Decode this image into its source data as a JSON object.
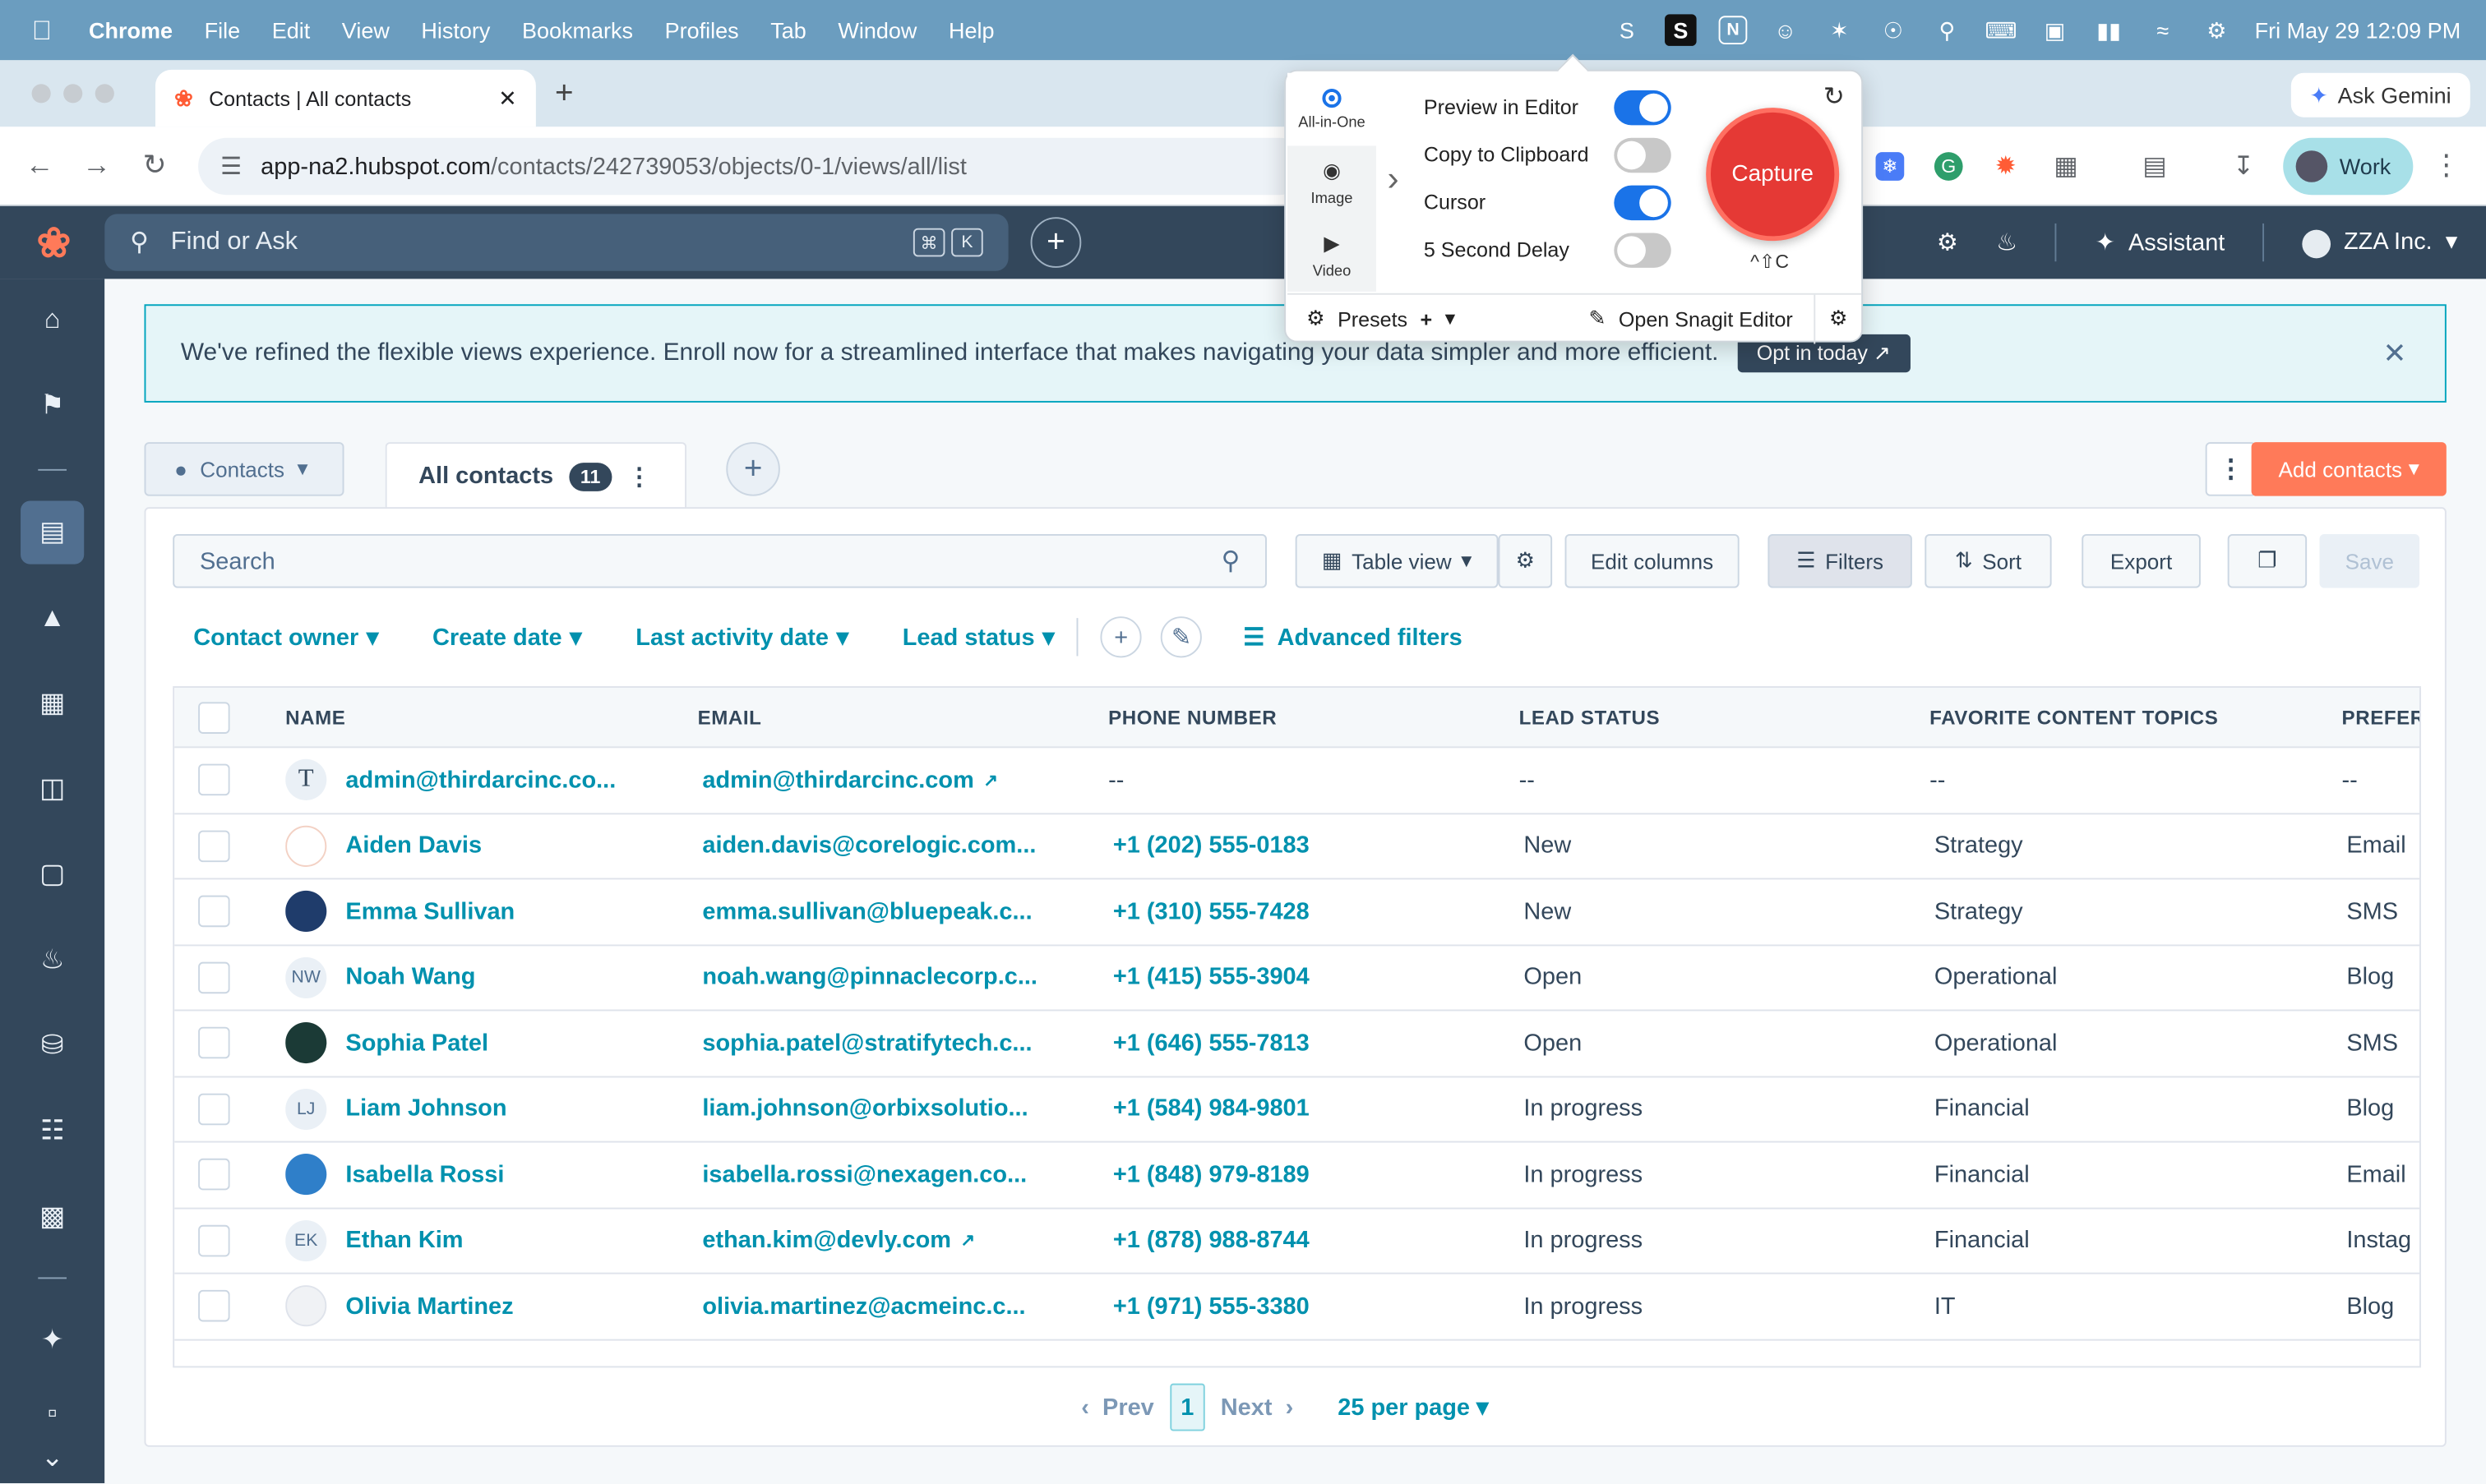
{
  "menubar": {
    "app": "Chrome",
    "items": [
      "File",
      "Edit",
      "View",
      "History",
      "Bookmarks",
      "Profiles",
      "Tab",
      "Window",
      "Help"
    ],
    "datetime": "Fri May 29  12:09 PM"
  },
  "browser": {
    "tab_title": "Contacts | All contacts",
    "url_host": "app-na2.hubspot.com",
    "url_path": "/contacts/242739053/objects/0-1/views/all/list",
    "ask_gemini": "Ask Gemini",
    "profile": "Work"
  },
  "hubspot": {
    "search_placeholder": "Find or Ask",
    "kbd1": "⌘",
    "kbd2": "K",
    "assistant": "Assistant",
    "account": "ZZA Inc."
  },
  "banner": {
    "text": "We've refined the flexible views experience. Enroll now for a streamlined interface that makes navigating your data simpler and more efficient.",
    "button": "Opt in today"
  },
  "views": {
    "object_selector": "Contacts",
    "active_view": "All contacts",
    "count": "11",
    "add_contacts": "Add contacts"
  },
  "toolbar": {
    "search_placeholder": "Search",
    "table_view": "Table view",
    "edit_columns": "Edit columns",
    "filters": "Filters",
    "sort": "Sort",
    "export": "Export",
    "save": "Save"
  },
  "filters": {
    "contact_owner": "Contact owner",
    "create_date": "Create date",
    "last_activity": "Last activity date",
    "lead_status": "Lead status",
    "advanced": "Advanced filters"
  },
  "table": {
    "headers": {
      "name": "NAME",
      "email": "EMAIL",
      "phone": "PHONE NUMBER",
      "lead_status": "LEAD STATUS",
      "topics": "FAVORITE CONTENT TOPICS",
      "pref": "PREFER"
    },
    "rows": [
      {
        "avatar": "T",
        "name": "admin@thirdarcinc.co...",
        "email": "admin@thirdarcinc.com",
        "phone": "--",
        "status": "--",
        "topic": "--",
        "pref": "--"
      },
      {
        "avatar": "",
        "name": "Aiden Davis",
        "email": "aiden.davis@corelogic.com...",
        "phone": "+1 (202) 555-0183",
        "status": "New",
        "topic": "Strategy",
        "pref": "Email"
      },
      {
        "avatar": "",
        "name": "Emma Sullivan",
        "email": "emma.sullivan@bluepeak.c...",
        "phone": "+1 (310) 555-7428",
        "status": "New",
        "topic": "Strategy",
        "pref": "SMS"
      },
      {
        "avatar": "NW",
        "name": "Noah Wang",
        "email": "noah.wang@pinnaclecorp.c...",
        "phone": "+1 (415) 555-3904",
        "status": "Open",
        "topic": "Operational",
        "pref": "Blog"
      },
      {
        "avatar": "",
        "name": "Sophia Patel",
        "email": "sophia.patel@stratifytech.c...",
        "phone": "+1 (646) 555-7813",
        "status": "Open",
        "topic": "Operational",
        "pref": "SMS"
      },
      {
        "avatar": "LJ",
        "name": "Liam Johnson",
        "email": "liam.johnson@orbixsolutio...",
        "phone": "+1 (584) 984-9801",
        "status": "In progress",
        "topic": "Financial",
        "pref": "Blog"
      },
      {
        "avatar": "",
        "name": "Isabella Rossi",
        "email": "isabella.rossi@nexagen.co...",
        "phone": "+1 (848) 979-8189",
        "status": "In progress",
        "topic": "Financial",
        "pref": "Email"
      },
      {
        "avatar": "EK",
        "name": "Ethan Kim",
        "email": "ethan.kim@devly.com",
        "phone": "+1 (878) 988-8744",
        "status": "In progress",
        "topic": "Financial",
        "pref": "Instag"
      },
      {
        "avatar": "",
        "name": "Olivia Martinez",
        "email": "olivia.martinez@acmeinc.c...",
        "phone": "+1 (971) 555-3380",
        "status": "In progress",
        "topic": "IT",
        "pref": "Blog"
      }
    ]
  },
  "pager": {
    "prev": "Prev",
    "page": "1",
    "next": "Next",
    "per_page": "25 per page"
  },
  "snagit": {
    "modes": [
      "All-in-One",
      "Image",
      "Video"
    ],
    "preview": "Preview in Editor",
    "clipboard": "Copy to Clipboard",
    "cursor": "Cursor",
    "delay": "5 Second Delay",
    "capture": "Capture",
    "shortcut": "^⇧C",
    "presets": "Presets",
    "open_editor": "Open Snagit Editor"
  }
}
